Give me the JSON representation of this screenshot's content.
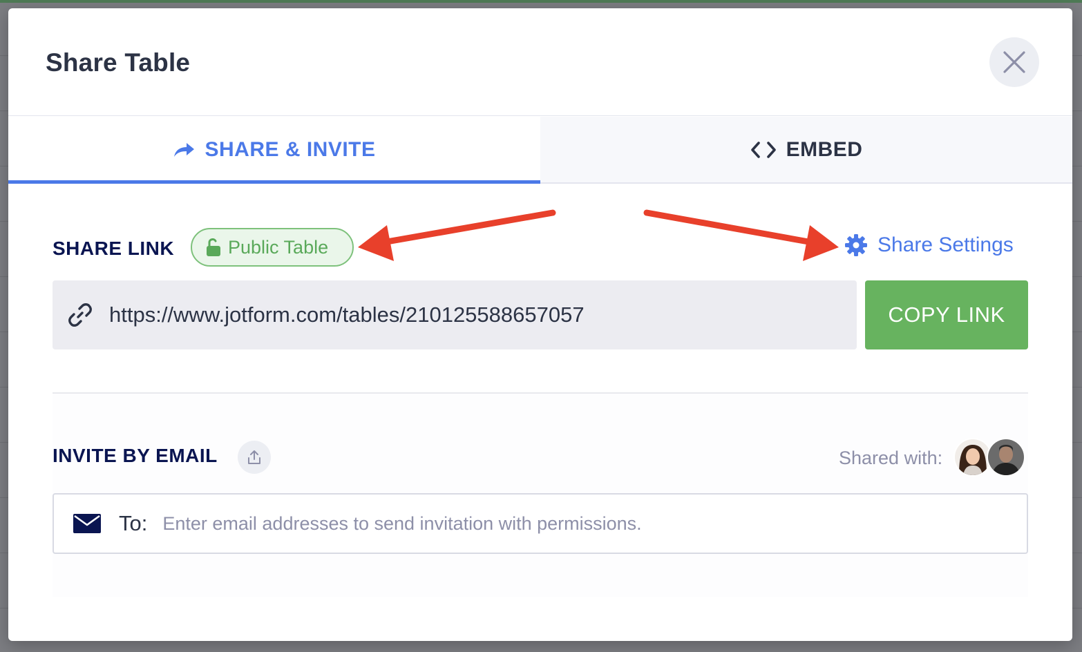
{
  "modal": {
    "title": "Share Table"
  },
  "tabs": [
    {
      "label": "SHARE & INVITE",
      "icon": "share-arrow-icon",
      "active": true
    },
    {
      "label": "EMBED",
      "icon": "code-icon",
      "active": false
    }
  ],
  "share_link": {
    "label": "SHARE LINK",
    "badge": "Public Table",
    "settings_label": "Share Settings",
    "url": "https://www.jotform.com/tables/210125588657057",
    "copy_label": "COPY LINK"
  },
  "invite": {
    "label": "INVITE BY EMAIL",
    "shared_with_label": "Shared with:",
    "to_label": "To:",
    "placeholder": "Enter email addresses to send invitation with permissions."
  },
  "colors": {
    "accent": "#4b79e8",
    "success": "#67b35f",
    "annotation": "#e8402b"
  }
}
